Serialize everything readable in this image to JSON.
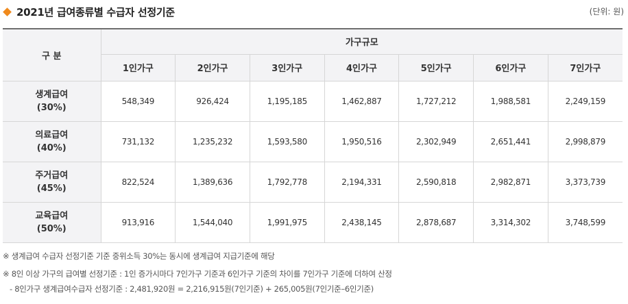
{
  "header": {
    "title": "2021년 급여종류별 수급자 선정기준",
    "unit": "(단위: 원)",
    "accent_color": "#f08a1c"
  },
  "table": {
    "gubun_label": "구 분",
    "group_label": "가구규모",
    "columns": [
      "1인가구",
      "2인가구",
      "3인가구",
      "4인가구",
      "5인가구",
      "6인가구",
      "7인가구"
    ],
    "rows": [
      {
        "name": "생계급여",
        "pct": "(30%)",
        "values": [
          "548,349",
          "926,424",
          "1,195,185",
          "1,462,887",
          "1,727,212",
          "1,988,581",
          "2,249,159"
        ]
      },
      {
        "name": "의료급여",
        "pct": "(40%)",
        "values": [
          "731,132",
          "1,235,232",
          "1,593,580",
          "1,950,516",
          "2,302,949",
          "2,651,441",
          "2,998,879"
        ]
      },
      {
        "name": "주거급여",
        "pct": "(45%)",
        "values": [
          "822,524",
          "1,389,636",
          "1,792,778",
          "2,194,331",
          "2,590,818",
          "2,982,871",
          "3,373,739"
        ]
      },
      {
        "name": "교육급여",
        "pct": "(50%)",
        "values": [
          "913,916",
          "1,544,040",
          "1,991,975",
          "2,438,145",
          "2,878,687",
          "3,314,302",
          "3,748,599"
        ]
      }
    ]
  },
  "notes": {
    "note1": "※ 생계급여 수급자 선정기준 기준 중위소득 30%는 동시에 생계급여 지급기준에 해당",
    "note2": "※ 8인 이상 가구의 급여별 선정기준 : 1인 증가시마다 7인가구 기준과 6인가구 기준의 차이를 7인가구 기준에 더하여 산정",
    "note3": "- 8인가구 생계급여수급자 선정기준 : 2,481,920원 = 2,216,915원(7인기준) + 265,005원(7인기준–6인기준)"
  }
}
